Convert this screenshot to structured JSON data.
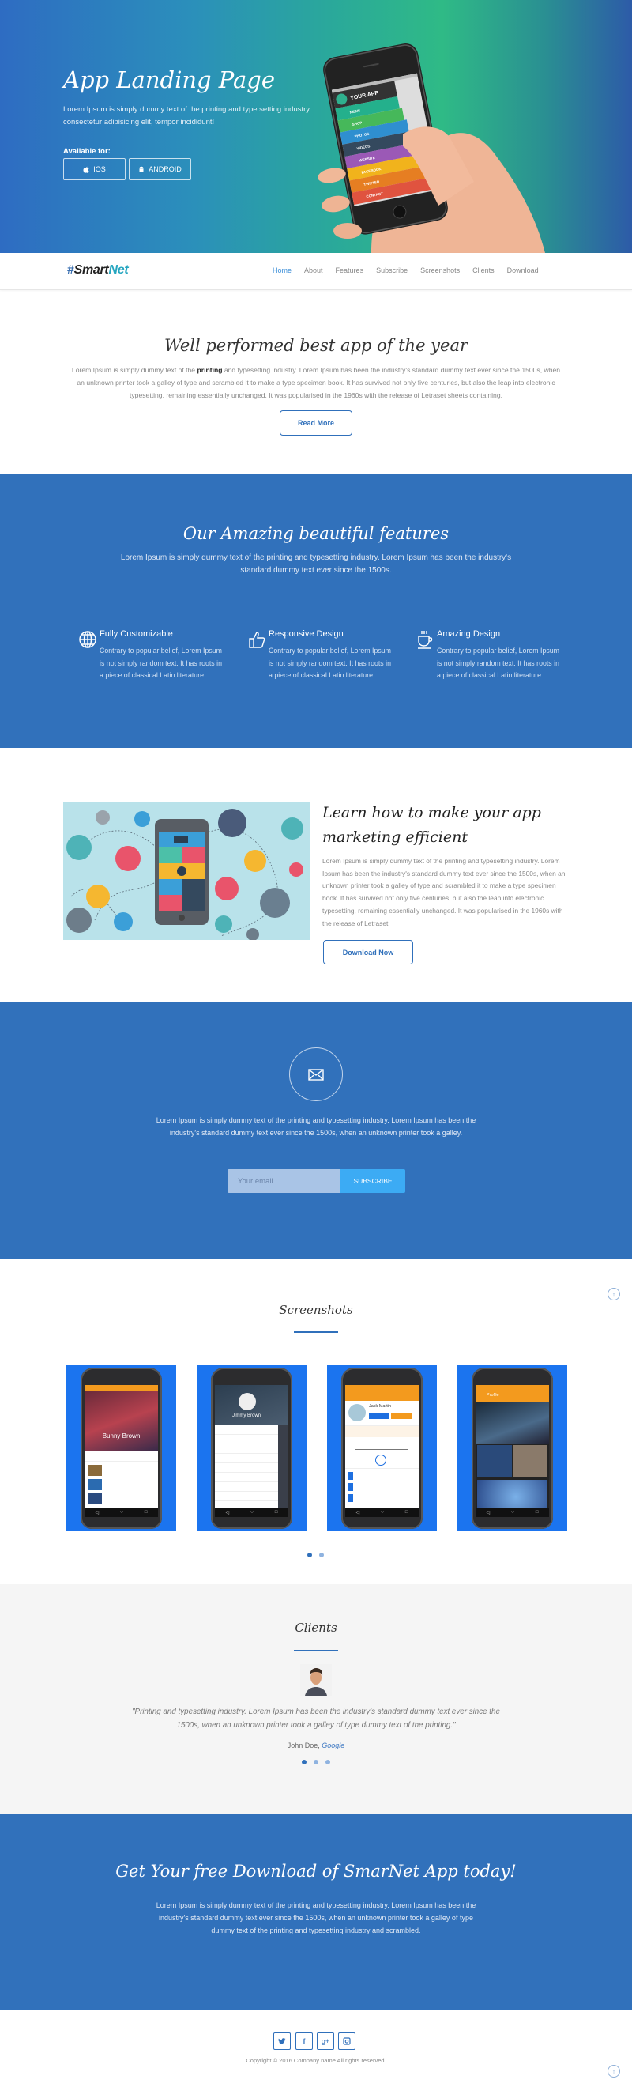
{
  "colors": {
    "brand_blue": "#3171bb",
    "accent_light_blue": "#3cabf4",
    "nav_active": "#3d8fd8",
    "logo_net": "#26a6c0",
    "screenshot_bg": "#1b74ef"
  },
  "hero": {
    "title": "App Landing Page",
    "lead": "Lorem Ipsum is simply dummy text of the printing and type setting industry consectetur adipisicing elit, tempor incididunt!",
    "available_label": "Available for:",
    "buttons": [
      {
        "label": "IOS",
        "icon": "apple-icon"
      },
      {
        "label": "ANDROID",
        "icon": "android-icon"
      }
    ],
    "phone_app": {
      "header": "YOUR APP",
      "menu": [
        "NEWS",
        "SHOP",
        "PHOTOS",
        "VIDEOS",
        "WEBSITE",
        "FACEBOOK",
        "TWITTER",
        "CONTACT"
      ],
      "menu_colors": [
        "#24b08c",
        "#46b85a",
        "#2f8fd0",
        "#34495e",
        "#9b59b6",
        "#f1b31c",
        "#e67e22",
        "#e0533f"
      ]
    }
  },
  "nav": {
    "logo": {
      "hash": "#",
      "part1": "Smart",
      "part2": "Net"
    },
    "items": [
      {
        "label": "Home",
        "active": true
      },
      {
        "label": "About"
      },
      {
        "label": "Features"
      },
      {
        "label": "Subscribe"
      },
      {
        "label": "Screenshots"
      },
      {
        "label": "Clients"
      },
      {
        "label": "Download"
      }
    ]
  },
  "about": {
    "title": "Well performed best app of the year",
    "para_before": "Lorem Ipsum is simply dummy text of the ",
    "para_bold": "printing",
    "para_after": " and typesetting industry. Lorem Ipsum has been the industry's standard dummy text ever since the 1500s, when an unknown printer took a galley of type and scrambled it to make a type specimen book. It has survived not only five centuries, but also the leap into electronic typesetting, remaining essentially unchanged. It was popularised in the 1960s with the release of Letraset sheets containing.",
    "button": "Read More"
  },
  "features": {
    "title": "Our Amazing beautiful features",
    "subtitle": "Lorem Ipsum is simply dummy text of the printing and typesetting industry. Lorem Ipsum has been the industry's standard dummy text ever since the 1500s.",
    "items": [
      {
        "icon": "globe-icon",
        "title": "Fully Customizable",
        "desc": "Contrary to popular belief, Lorem Ipsum is not simply random text. It has roots in a piece of classical Latin literature."
      },
      {
        "icon": "thumbs-up-icon",
        "title": "Responsive Design",
        "desc": "Contrary to popular belief, Lorem Ipsum is not simply random text. It has roots in a piece of classical Latin literature."
      },
      {
        "icon": "coffee-cup-icon",
        "title": "Amazing Design",
        "desc": "Contrary to popular belief, Lorem Ipsum is not simply random text. It has roots in a piece of classical Latin literature."
      }
    ]
  },
  "learn": {
    "title": "Learn how to make your app marketing efficient",
    "para": "Lorem Ipsum is simply dummy text of the printing and typesetting industry. Lorem Ipsum has been the industry's standard dummy text ever since the 1500s, when an unknown printer took a galley of type and scrambled it to make a type specimen book. It has survived not only five centuries, but also the leap into electronic typesetting, remaining essentially unchanged. It was popularised in the 1960s with the release of Letraset.",
    "button": "Download Now"
  },
  "subscribe": {
    "icon": "envelope-icon",
    "para": "Lorem Ipsum is simply dummy text of the printing and typesetting industry. Lorem Ipsum has been the industry's standard dummy text ever since the 1500s, when an unknown printer took a galley.",
    "email_placeholder": "Your email...",
    "button": "SUBSCRIBE"
  },
  "screenshots": {
    "title": "Screenshots",
    "phones": [
      {
        "text": "Bunny Brown"
      },
      {
        "text": "Jimmy Brown"
      },
      {
        "text": "Jack Martin"
      },
      {
        "text": "Profile"
      }
    ],
    "pager": {
      "count": 2,
      "active": 0
    }
  },
  "clients": {
    "title": "Clients",
    "quote": "\"Printing and typesetting industry. Lorem Ipsum has been the industry's standard dummy text ever since the 1500s, when an unknown printer took a galley of type dummy text of the printing.\"",
    "author": "John Doe,",
    "company": "Google",
    "pager": {
      "count": 3,
      "active": 0
    }
  },
  "download": {
    "title": "Get Your free Download of SmarNet App today!",
    "para": "Lorem Ipsum is simply dummy text of the printing and typesetting industry. Lorem Ipsum has been the industry's standard dummy text ever since the 1500s, when an unknown printer took a galley of type dummy text of the printing and typesetting industry and scrambled."
  },
  "footer": {
    "social": [
      {
        "icon": "twitter-icon",
        "glyph": "t"
      },
      {
        "icon": "facebook-icon",
        "glyph": "f"
      },
      {
        "icon": "google-plus-icon",
        "glyph": "g+"
      },
      {
        "icon": "instagram-icon",
        "glyph": "◙"
      }
    ],
    "copyright": "Copyright © 2016 Company name All rights reserved."
  }
}
